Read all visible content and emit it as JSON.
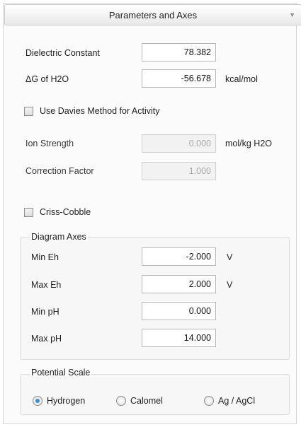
{
  "header": {
    "title": "Parameters and Axes"
  },
  "dielectric": {
    "label": "Dielectric Constant",
    "value": "78.382"
  },
  "delta_g": {
    "label": "ΔG of H2O",
    "value": "-56.678",
    "unit": "kcal/mol"
  },
  "davies": {
    "label": "Use Davies Method for Activity",
    "checked": false
  },
  "ion_strength": {
    "label": "Ion Strength",
    "value": "0.000",
    "unit": "mol/kg H2O"
  },
  "correction": {
    "label": "Correction Factor",
    "value": "1.000"
  },
  "criss_cobble": {
    "label": "Criss-Cobble",
    "checked": false
  },
  "axes": {
    "title": "Diagram Axes",
    "min_eh": {
      "label": "Min Eh",
      "value": "-2.000",
      "unit": "V"
    },
    "max_eh": {
      "label": "Max Eh",
      "value": "2.000",
      "unit": "V"
    },
    "min_ph": {
      "label": "Min pH",
      "value": "0.000"
    },
    "max_ph": {
      "label": "Max pH",
      "value": "14.000"
    }
  },
  "potential": {
    "title": "Potential Scale",
    "options": [
      "Hydrogen",
      "Calomel",
      "Ag / AgCl"
    ],
    "selected": "Hydrogen",
    "accent_color": "#3d8fd6"
  }
}
